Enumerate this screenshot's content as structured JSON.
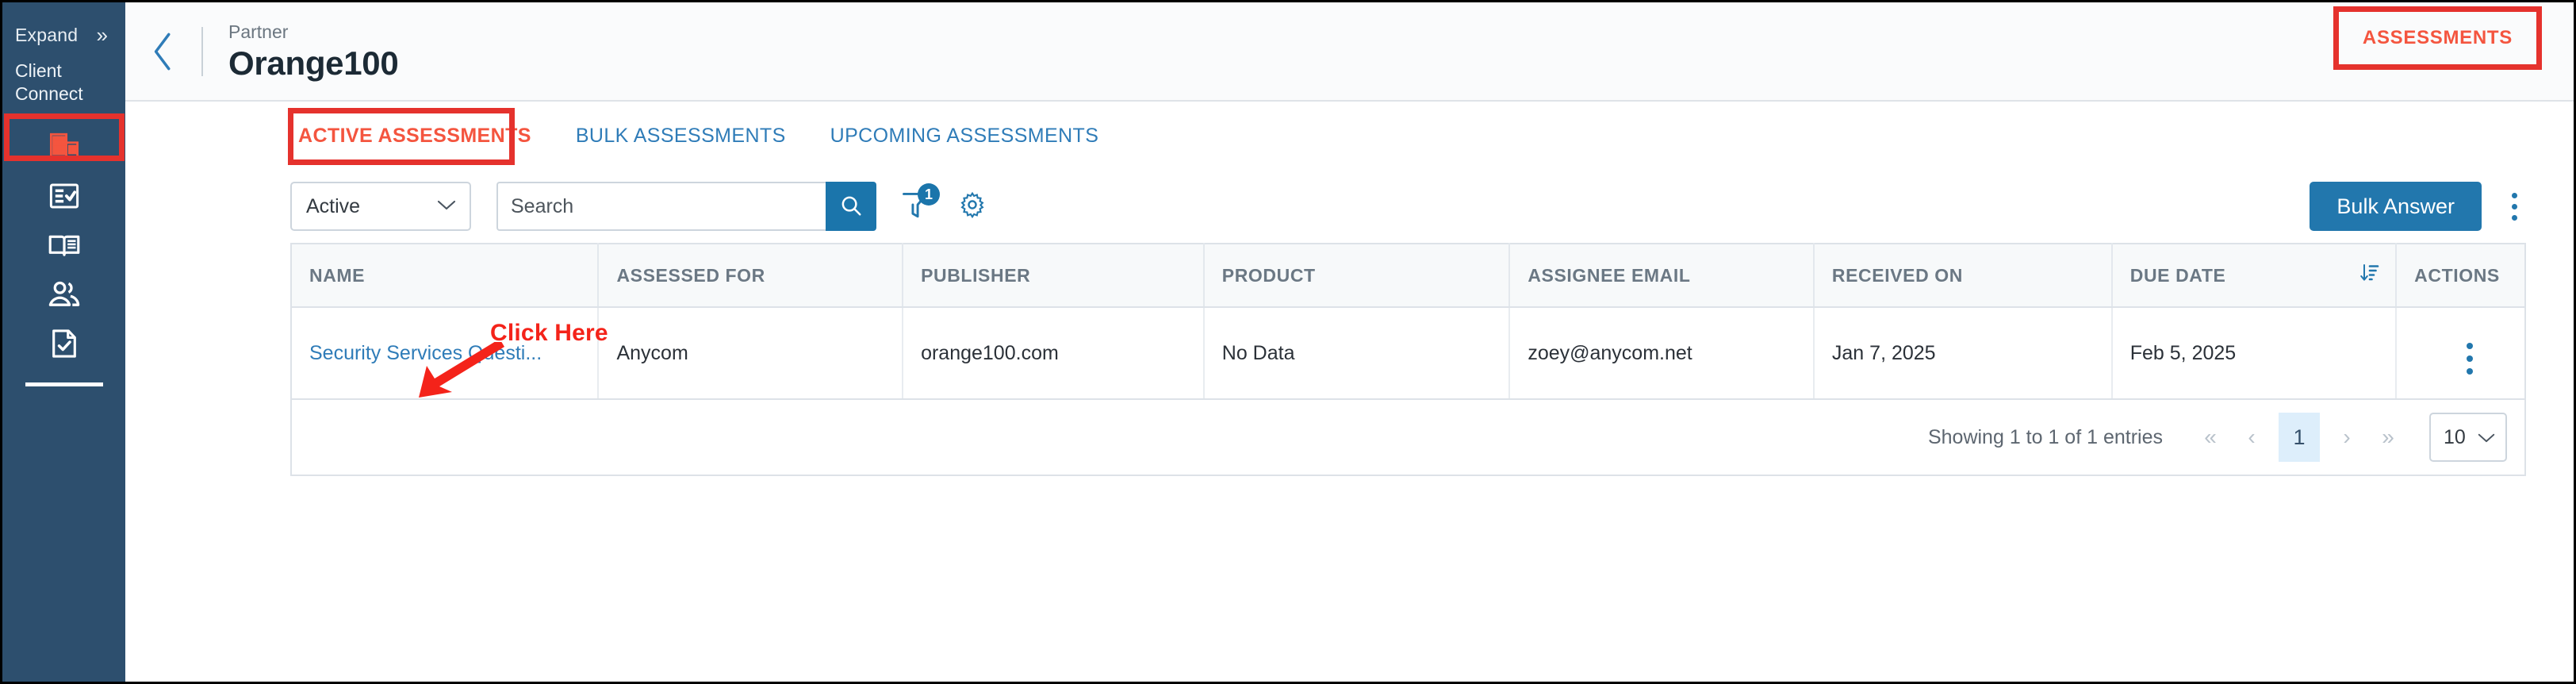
{
  "sidebar": {
    "expand_label": "Expand",
    "expand_icon": "double-chevron-right-icon",
    "brand_line1": "Client",
    "brand_line2": "Connect",
    "items": [
      {
        "icon": "building-icon",
        "name": "companies",
        "active": true
      },
      {
        "icon": "clipboard-check-icon",
        "name": "assessments",
        "active": false
      },
      {
        "icon": "open-book-icon",
        "name": "library",
        "active": false
      },
      {
        "icon": "users-icon",
        "name": "users",
        "active": false
      },
      {
        "icon": "document-check-icon",
        "name": "reports",
        "active": false
      }
    ],
    "accent_active": "#f4553f",
    "background": "#2d4f6e"
  },
  "header": {
    "back_icon": "chevron-left-icon",
    "kicker": "Partner",
    "title": "Orange100",
    "assessments_label": "ASSESSMENTS"
  },
  "tabs": [
    {
      "label": "ACTIVE ASSESSMENTS",
      "active": true
    },
    {
      "label": "BULK ASSESSMENTS",
      "active": false
    },
    {
      "label": "UPCOMING ASSESSMENTS",
      "active": false
    }
  ],
  "toolbar": {
    "status_filter_value": "Active",
    "status_filter_icon": "chevron-down-icon",
    "search_placeholder": "Search",
    "search_value": "",
    "search_icon": "search-icon",
    "filter_icon": "funnel-icon",
    "filter_badge_count": "1",
    "settings_icon": "gear-icon",
    "bulk_answer_label": "Bulk Answer",
    "overflow_icon": "kebab-menu-icon"
  },
  "table": {
    "columns": [
      "NAME",
      "ASSESSED FOR",
      "PUBLISHER",
      "PRODUCT",
      "ASSIGNEE EMAIL",
      "RECEIVED ON",
      "DUE DATE",
      "ACTIONS"
    ],
    "sort_column": "DUE DATE",
    "sort_icon": "sort-descending-icon",
    "rows": [
      {
        "name": "Security Services Questi...",
        "assessed_for": "Anycom",
        "publisher": "orange100.com",
        "product": "No Data",
        "assignee_email": "zoey@anycom.net",
        "received_on": "Jan 7, 2025",
        "due_date": "Feb 5, 2025",
        "actions_icon": "kebab-menu-icon"
      }
    ]
  },
  "pagination": {
    "summary": "Showing 1 to 1 of 1 entries",
    "first_label": "«",
    "prev_label": "‹",
    "current_page": "1",
    "next_label": "›",
    "last_label": "»",
    "page_size": "10",
    "page_size_icon": "chevron-down-icon"
  },
  "annotation": {
    "click_here_label": "Click Here",
    "arrow_icon": "arrow-pointing-down-left-icon",
    "highlight_color": "#e5322d"
  }
}
